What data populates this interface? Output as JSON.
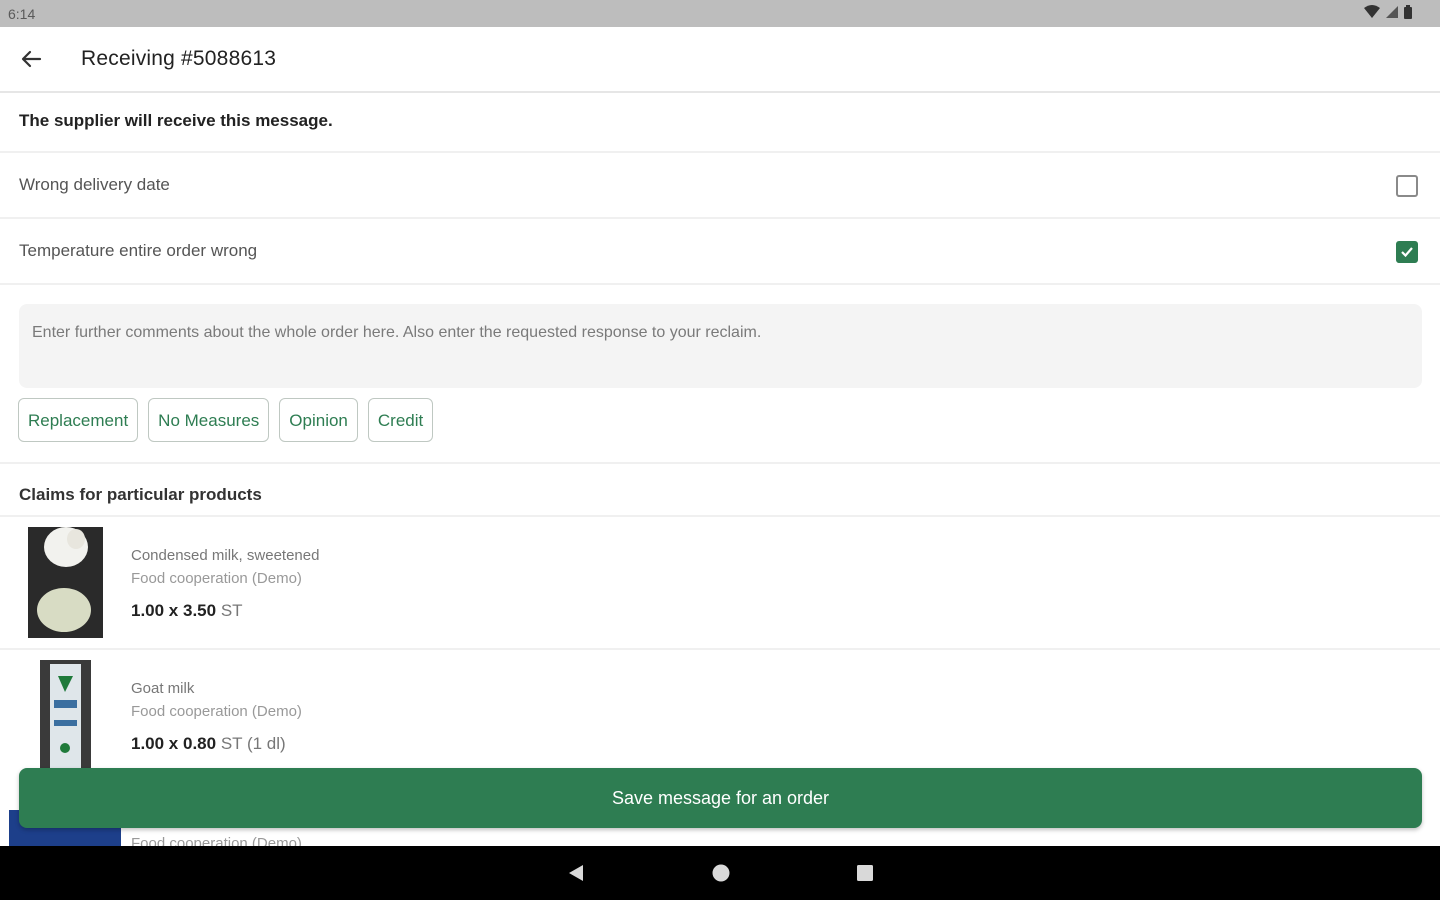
{
  "status": {
    "time": "6:14"
  },
  "header": {
    "title": "Receiving #5088613"
  },
  "notice": "The supplier will receive this message.",
  "reasons": [
    {
      "label": "Wrong delivery date",
      "checked": false
    },
    {
      "label": "Temperature entire order wrong",
      "checked": true
    }
  ],
  "comment": {
    "placeholder": "Enter further comments about the whole order here. Also enter the requested response to your reclaim."
  },
  "chips": [
    "Replacement",
    "No Measures",
    "Opinion",
    "Credit"
  ],
  "section_title": "Claims for particular products",
  "products": [
    {
      "name": "Condensed milk, sweetened",
      "supplier": "Food cooperation (Demo)",
      "qty": "1.00 x 3.50",
      "unit": "ST",
      "extra": ""
    },
    {
      "name": "Goat milk",
      "supplier": "Food cooperation (Demo)",
      "qty": "1.00 x 0.80",
      "unit": "ST",
      "extra": "(1 dl)"
    },
    {
      "name": "",
      "supplier": "Food cooperation (Demo)",
      "qty": "",
      "unit": "",
      "extra": ""
    }
  ],
  "save_button": "Save message for an order",
  "colors": {
    "accent": "#2e7d52",
    "statusbar": "#bdbdbd",
    "navbar": "#000000"
  },
  "icons": {
    "back": "arrow-left-icon",
    "wifi": "wifi-icon",
    "signal": "signal-icon",
    "battery": "battery-icon"
  }
}
